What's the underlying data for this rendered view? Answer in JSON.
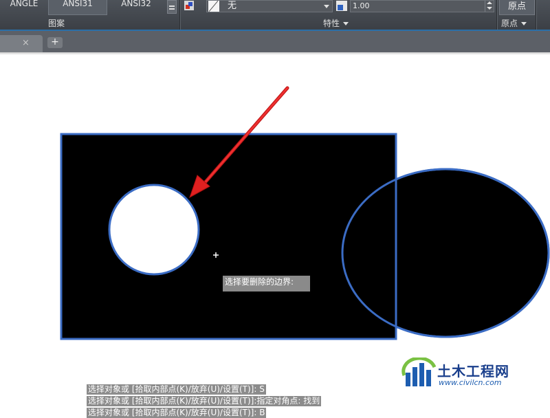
{
  "ribbon": {
    "patterns": [
      "ANGLE",
      "ANSI31",
      "ANSI32"
    ],
    "pattern_panel_label": "图案",
    "color_value": "无",
    "scale_value": "1.00",
    "properties_panel_label": "特性",
    "origin_button": "原点",
    "origin_panel_label": "原点"
  },
  "tabs": {
    "close_symbol": "×",
    "add_symbol": "+"
  },
  "canvas": {
    "prompt_tooltip": "选择要删除的边界:",
    "command_lines": [
      "选择对象或 [拾取内部点(K)/放弃(U)/设置(T)]: S",
      "选择对象或 [拾取内部点(K)/放弃(U)/设置(T)]:指定对角点: 找到",
      "选择对象或 [拾取内部点(K)/放弃(U)/设置(T)]: B"
    ]
  },
  "watermark": {
    "name": "土木工程网",
    "url": "www.civilcn.com"
  },
  "colors": {
    "ribbon_bg": "#42464c",
    "accent_line": "#2b6fa8",
    "hatch_fill": "#000000",
    "boundary_glow": "#3b6cc4",
    "arrow": "#e02020"
  }
}
